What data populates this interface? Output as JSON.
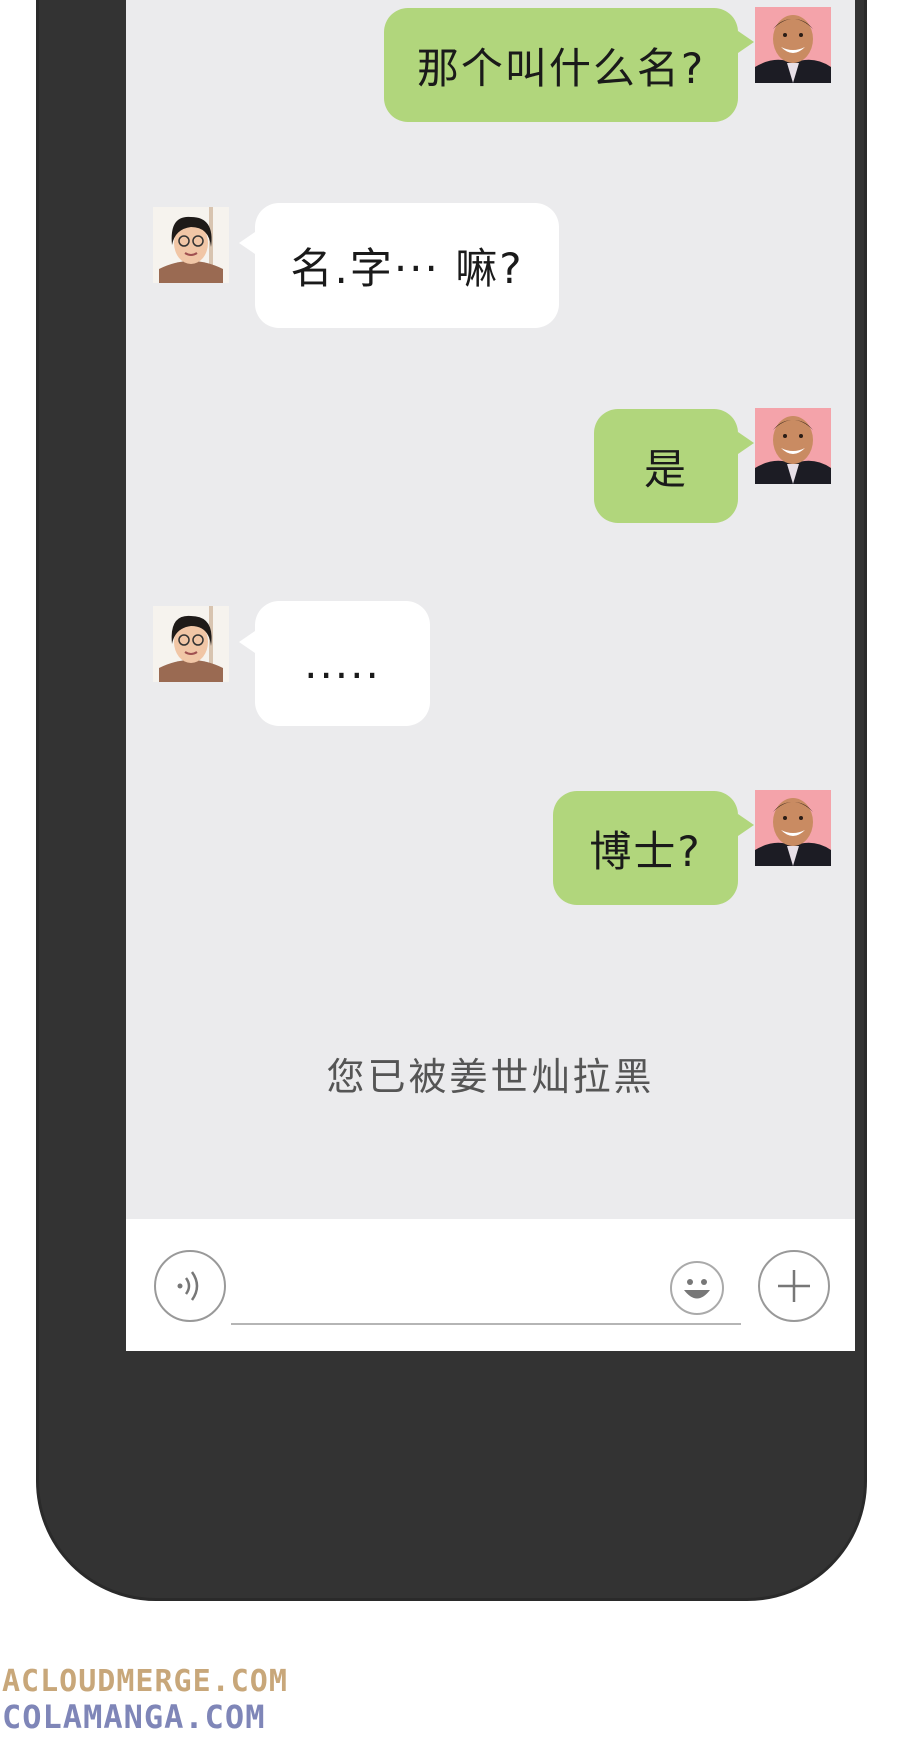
{
  "chat": {
    "messages": [
      {
        "side": "out",
        "text": "那个叫什么名?",
        "avatar": "man-smiling-avatar"
      },
      {
        "side": "in",
        "text": "名.字··· 嘛?",
        "avatar": "woman-glasses-avatar"
      },
      {
        "side": "out",
        "text": "是",
        "avatar": "man-smiling-avatar"
      },
      {
        "side": "in",
        "text": ".....",
        "avatar": "woman-glasses-avatar"
      },
      {
        "side": "out",
        "text": "博士?",
        "avatar": "man-smiling-avatar"
      }
    ],
    "blocked_notice": "您已被姜世灿拉黑"
  },
  "input_bar": {
    "voice_icon": "voice-wave-icon",
    "emoji_icon": "smiley-face-icon",
    "add_icon": "plus-icon",
    "value": ""
  },
  "watermark": {
    "line1": "ACLOUDMERGE.COM",
    "line2": "COLAMANGA.COM"
  },
  "colors": {
    "outgoing_bubble": "#b1d67c",
    "incoming_bubble": "#ffffff",
    "screen_bg": "#ebebed",
    "phone_frame": "#333333"
  }
}
